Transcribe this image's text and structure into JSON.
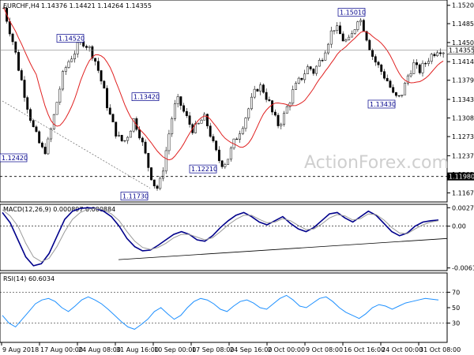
{
  "chart_data": [
    {
      "type": "candlestick",
      "header": {
        "symbol": "EURCHF,H4",
        "ohlc": "1.14376 1.14421 1.14264 1.14355"
      },
      "y_ticks": [
        "1.15200",
        "1.14855",
        "1.14500",
        "1.14140",
        "1.13790",
        "1.13430",
        "1.13080",
        "1.12730",
        "1.12370",
        "1.12020",
        "1.11670"
      ],
      "ylim": [
        1.115,
        1.153
      ],
      "current_price": "1.14355",
      "level_price": "1.11980",
      "annotations": [
        {
          "label": "1.15010",
          "price": 1.1501
        },
        {
          "label": "1.14520",
          "price": 1.1452
        },
        {
          "label": "1.13420",
          "price": 1.1342
        },
        {
          "label": "1.13430",
          "price": 1.1343
        },
        {
          "label": "1.12420",
          "price": 1.1242
        },
        {
          "label": "1.12210",
          "price": 1.1221
        },
        {
          "label": "1.11730",
          "price": 1.1173
        }
      ],
      "watermark": "ActionForex.com",
      "price_path": [
        1.1515,
        1.148,
        1.1445,
        1.14,
        1.136,
        1.132,
        1.1285,
        1.1262,
        1.1242,
        1.1265,
        1.131,
        1.1355,
        1.1395,
        1.1415,
        1.143,
        1.1445,
        1.1452,
        1.144,
        1.1425,
        1.1395,
        1.136,
        1.132,
        1.129,
        1.127,
        1.1262,
        1.128,
        1.1305,
        1.1285,
        1.125,
        1.1215,
        1.1185,
        1.1173,
        1.122,
        1.1275,
        1.1325,
        1.1342,
        1.132,
        1.13,
        1.1285,
        1.1295,
        1.131,
        1.129,
        1.1255,
        1.123,
        1.1221,
        1.1235,
        1.126,
        1.128,
        1.13,
        1.1325,
        1.135,
        1.137,
        1.136,
        1.134,
        1.131,
        1.1295,
        1.131,
        1.1335,
        1.136,
        1.1375,
        1.139,
        1.1405,
        1.1395,
        1.141,
        1.143,
        1.1455,
        1.148,
        1.147,
        1.1455,
        1.145,
        1.147,
        1.1501,
        1.148,
        1.145,
        1.142,
        1.1405,
        1.139,
        1.1375,
        1.135,
        1.1343,
        1.136,
        1.139,
        1.141,
        1.1395,
        1.1405,
        1.142,
        1.143,
        1.144,
        1.1435
      ]
    },
    {
      "type": "line",
      "title": "MACD(12,26,9) 0.000897 0.000884",
      "y_ticks": [
        "0.0027",
        "0.00",
        "-0.006114"
      ],
      "ylim": [
        -0.0065,
        0.0032
      ],
      "series": [
        {
          "name": "MACD",
          "color": "#00008b",
          "values": [
            0.002,
            0.0005,
            -0.002,
            -0.0045,
            -0.0058,
            -0.0055,
            -0.004,
            -0.0015,
            0.001,
            0.0022,
            0.0026,
            0.0027,
            0.0026,
            0.0022,
            0.0014,
            0.0,
            -0.0018,
            -0.003,
            -0.0036,
            -0.0035,
            -0.0028,
            -0.002,
            -0.0012,
            -0.0008,
            -0.0012,
            -0.002,
            -0.0022,
            -0.0014,
            -0.0002,
            0.0008,
            0.0016,
            0.002,
            0.0014,
            0.0006,
            0.0002,
            0.0008,
            0.0014,
            0.0004,
            -0.0004,
            -0.0008,
            -0.0002,
            0.0008,
            0.0018,
            0.002,
            0.0012,
            0.0006,
            0.0014,
            0.0022,
            0.0016,
            0.0004,
            -0.0008,
            -0.0014,
            -0.001,
            0.0,
            0.0006,
            0.0008,
            0.0009
          ]
        },
        {
          "name": "Signal",
          "color": "#999999",
          "values": [
            0.0024,
            0.0015,
            0.0,
            -0.0025,
            -0.0045,
            -0.0052,
            -0.0047,
            -0.003,
            -0.0008,
            0.001,
            0.002,
            0.0025,
            0.0026,
            0.0024,
            0.0018,
            0.0008,
            -0.0008,
            -0.0022,
            -0.0031,
            -0.0034,
            -0.0031,
            -0.0025,
            -0.0017,
            -0.0012,
            -0.0012,
            -0.0016,
            -0.002,
            -0.0017,
            -0.0008,
            0.0002,
            0.001,
            0.0016,
            0.0016,
            0.001,
            0.0005,
            0.0006,
            0.0011,
            0.0008,
            0.0001,
            -0.0005,
            -0.0004,
            0.0003,
            0.0012,
            0.0017,
            0.0015,
            0.0009,
            0.0011,
            0.0018,
            0.0017,
            0.0009,
            -0.0002,
            -0.001,
            -0.0011,
            -0.0004,
            0.0002,
            0.0006,
            0.0008
          ]
        }
      ]
    },
    {
      "type": "line",
      "title": "RSI(14) 60.6034",
      "y_ticks": [
        "70",
        "50",
        "30"
      ],
      "ylim": [
        5,
        95
      ],
      "series": [
        {
          "name": "RSI(14)",
          "color": "#1e90ff",
          "values": [
            40,
            30,
            25,
            35,
            45,
            55,
            60,
            62,
            58,
            50,
            45,
            52,
            60,
            64,
            60,
            55,
            48,
            40,
            32,
            25,
            22,
            28,
            35,
            45,
            50,
            42,
            35,
            40,
            50,
            58,
            62,
            60,
            55,
            48,
            45,
            52,
            58,
            60,
            56,
            50,
            48,
            55,
            62,
            66,
            60,
            52,
            50,
            56,
            62,
            64,
            58,
            50,
            44,
            40,
            36,
            42,
            50,
            54,
            52,
            48,
            52,
            56,
            58,
            60,
            62,
            61,
            60
          ]
        }
      ]
    }
  ],
  "x_ticks": [
    "9 Aug 2018",
    "17 Aug 00:00",
    "24 Aug 08:00",
    "31 Aug 16:00",
    "10 Sep 00:00",
    "17 Sep 08:00",
    "24 Sep 16:00",
    "2 Oct 00:00",
    "9 Oct 08:00",
    "16 Oct 16:00",
    "24 Oct 00:00",
    "31 Oct 08:00"
  ],
  "colors": {
    "ma": "#e02020",
    "candle": "#000000",
    "macd_trend": "#000000",
    "level_bg": "#000000"
  }
}
